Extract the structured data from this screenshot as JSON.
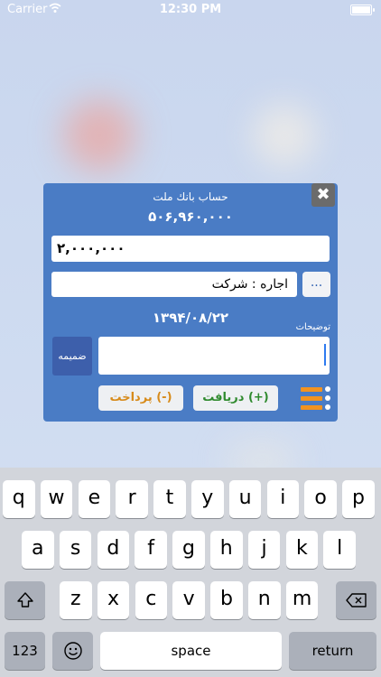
{
  "status_bar": {
    "carrier": "Carrier",
    "time": "12:30 PM"
  },
  "dialog": {
    "close_label": "✖",
    "account_title": "حساب بانك ملت",
    "account_balance": "۵۰۶,۹۶۰,۰۰۰",
    "amount_value": "۲,۰۰۰,۰۰۰",
    "category_value": "اجاره : شرکت",
    "more_label": "...",
    "date": "۱۳۹۴/۰۸/۲۲",
    "notes_label": "توضیحات",
    "notes_value": "",
    "attach_label": "ضمیمه",
    "pay_label": "پرداخت (-)",
    "receive_label": "دریافت (+)",
    "list_icon": "list-icon",
    "colors": {
      "panel": "#4a7cc5",
      "pay": "#d78b1b",
      "receive": "#2f8a2e",
      "list_bars": "#f29320"
    }
  },
  "keyboard": {
    "row1": [
      "q",
      "w",
      "e",
      "r",
      "t",
      "y",
      "u",
      "i",
      "o",
      "p"
    ],
    "row2": [
      "a",
      "s",
      "d",
      "f",
      "g",
      "h",
      "j",
      "k",
      "l"
    ],
    "row3": [
      "z",
      "x",
      "c",
      "v",
      "b",
      "n",
      "m"
    ],
    "shift_icon": "shift-icon",
    "backspace_icon": "backspace-icon",
    "numbers_label": "123",
    "emoji_icon": "emoji-icon",
    "space_label": "space",
    "return_label": "return"
  }
}
